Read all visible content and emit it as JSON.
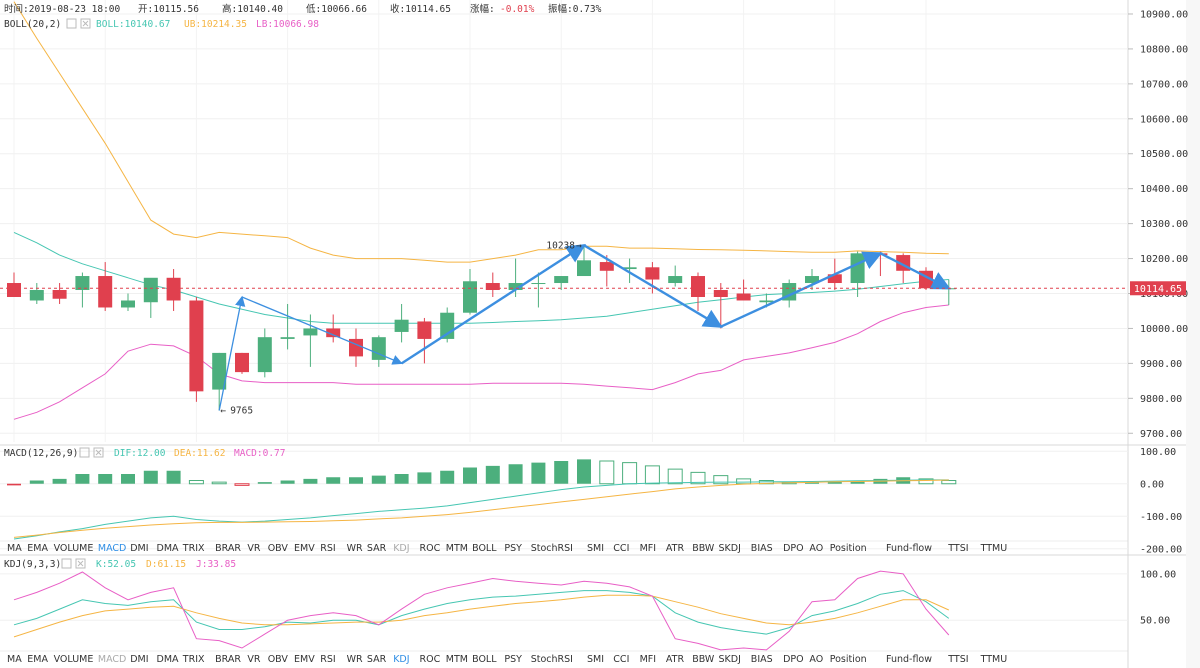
{
  "header": {
    "time": "时间:2019-08-23 18:00",
    "open": "开:10115.56",
    "high": "高:10140.40",
    "low": "低:10066.66",
    "close": "收:10114.65",
    "change_label": "涨幅:",
    "change_value": "-0.01%",
    "amplitude": "振幅:0.73%"
  },
  "boll": {
    "label": "BOLL(20,2)",
    "mid": "BOLL:10140.67",
    "ub": "UB:10214.35",
    "lb": "LB:10066.98"
  },
  "macd": {
    "label": "MACD(12,26,9)",
    "dif": "DIF:12.00",
    "dea": "DEA:11.62",
    "macd": "MACD:0.77"
  },
  "kdj": {
    "label": "KDJ(9,3,3)",
    "k": "K:52.05",
    "d": "D:61.15",
    "j": "J:33.85"
  },
  "annotations": {
    "high_marker": "10238",
    "low_marker": "9765",
    "current_price": "10114.65"
  },
  "price_axis": [
    "10900.00",
    "10800.00",
    "10700.00",
    "10600.00",
    "10500.00",
    "10400.00",
    "10300.00",
    "10200.00",
    "10100.00",
    "10000.00",
    "9900.00",
    "9800.00",
    "9700.00"
  ],
  "macd_axis": [
    "100.00",
    "0.00",
    "-100.00",
    "-200.00"
  ],
  "kdj_axis": [
    "100.00",
    "50.00"
  ],
  "indicator_tabs": [
    "MA",
    "EMA",
    "VOLUME",
    "MACD",
    "DMI",
    "DMA",
    "TRIX",
    "BRAR",
    "VR",
    "OBV",
    "EMV",
    "RSI",
    "WR",
    "SAR",
    "KDJ",
    "ROC",
    "MTM",
    "BOLL",
    "PSY",
    "StochRSI",
    "SMI",
    "CCI",
    "MFI",
    "ATR",
    "BBW",
    "SKDJ",
    "BIAS",
    "DPO",
    "AO",
    "Position",
    "Fund-flow",
    "TTSI",
    "TTMU"
  ],
  "active_tab_row1": "MACD",
  "dim_tab_row1": "KDJ",
  "active_tab_row2": "KDJ",
  "dim_tab_row2": "MACD",
  "colors": {
    "up": "#4caf7d",
    "down": "#e0404e",
    "mid_line": "#46c6b2",
    "upper_band": "#f5b544",
    "lower_band": "#e85fc6",
    "trend_arrows": "#3d8fe0",
    "macd_dif": "#46c6b2",
    "macd_dea": "#f5b544",
    "macd_value": "#e85fc6",
    "change_negative": "#e0404e"
  },
  "chart_data": [
    {
      "type": "candlestick",
      "title": "BOLL(20,2)",
      "ylim": [
        9675,
        10940
      ],
      "candles": [
        {
          "o": 10130,
          "h": 10160,
          "l": 10090,
          "c": 10090
        },
        {
          "o": 10080,
          "h": 10130,
          "l": 10070,
          "c": 10110
        },
        {
          "o": 10110,
          "h": 10130,
          "l": 10070,
          "c": 10085
        },
        {
          "o": 10110,
          "h": 10160,
          "l": 10060,
          "c": 10150
        },
        {
          "o": 10150,
          "h": 10190,
          "l": 10050,
          "c": 10060
        },
        {
          "o": 10060,
          "h": 10100,
          "l": 10050,
          "c": 10080
        },
        {
          "o": 10075,
          "h": 10140,
          "l": 10030,
          "c": 10145
        },
        {
          "o": 10145,
          "h": 10170,
          "l": 10050,
          "c": 10080
        },
        {
          "o": 10080,
          "h": 10090,
          "l": 9790,
          "c": 9820
        },
        {
          "o": 9825,
          "h": 9930,
          "l": 9765,
          "c": 9930
        },
        {
          "o": 9930,
          "h": 9930,
          "l": 9870,
          "c": 9875
        },
        {
          "o": 9875,
          "h": 10000,
          "l": 9860,
          "c": 9975
        },
        {
          "o": 9970,
          "h": 10070,
          "l": 9940,
          "c": 9975
        },
        {
          "o": 9980,
          "h": 10040,
          "l": 9890,
          "c": 10000
        },
        {
          "o": 10000,
          "h": 10040,
          "l": 9960,
          "c": 9975
        },
        {
          "o": 9970,
          "h": 10000,
          "l": 9890,
          "c": 9920
        },
        {
          "o": 9910,
          "h": 9980,
          "l": 9890,
          "c": 9975
        },
        {
          "o": 9990,
          "h": 10070,
          "l": 9960,
          "c": 10025
        },
        {
          "o": 10020,
          "h": 10030,
          "l": 9900,
          "c": 9970
        },
        {
          "o": 9970,
          "h": 10060,
          "l": 9960,
          "c": 10045
        },
        {
          "o": 10045,
          "h": 10170,
          "l": 10040,
          "c": 10135
        },
        {
          "o": 10130,
          "h": 10160,
          "l": 10090,
          "c": 10110
        },
        {
          "o": 10110,
          "h": 10200,
          "l": 10090,
          "c": 10130
        },
        {
          "o": 10130,
          "h": 10160,
          "l": 10060,
          "c": 10130
        },
        {
          "o": 10130,
          "h": 10150,
          "l": 10110,
          "c": 10150
        },
        {
          "o": 10150,
          "h": 10238,
          "l": 10150,
          "c": 10195
        },
        {
          "o": 10190,
          "h": 10210,
          "l": 10120,
          "c": 10165
        },
        {
          "o": 10170,
          "h": 10200,
          "l": 10130,
          "c": 10175
        },
        {
          "o": 10175,
          "h": 10190,
          "l": 10100,
          "c": 10140
        },
        {
          "o": 10130,
          "h": 10180,
          "l": 10120,
          "c": 10150
        },
        {
          "o": 10150,
          "h": 10160,
          "l": 10050,
          "c": 10090
        },
        {
          "o": 10110,
          "h": 10130,
          "l": 10000,
          "c": 10090
        },
        {
          "o": 10100,
          "h": 10140,
          "l": 10080,
          "c": 10080
        },
        {
          "o": 10075,
          "h": 10100,
          "l": 10060,
          "c": 10080
        },
        {
          "o": 10080,
          "h": 10140,
          "l": 10060,
          "c": 10130
        },
        {
          "o": 10130,
          "h": 10170,
          "l": 10110,
          "c": 10150
        },
        {
          "o": 10155,
          "h": 10200,
          "l": 10110,
          "c": 10130
        },
        {
          "o": 10130,
          "h": 10220,
          "l": 10090,
          "c": 10215
        },
        {
          "o": 10215,
          "h": 10220,
          "l": 10150,
          "c": 10210
        },
        {
          "o": 10210,
          "h": 10215,
          "l": 10130,
          "c": 10165
        },
        {
          "o": 10165,
          "h": 10175,
          "l": 10110,
          "c": 10115
        },
        {
          "o": 10115,
          "h": 10140,
          "l": 10067,
          "c": 10115
        }
      ],
      "series": [
        {
          "name": "BOLL",
          "values": [
            10275,
            10245,
            10210,
            10185,
            10165,
            10145,
            10125,
            10110,
            10090,
            10070,
            10055,
            10040,
            10030,
            10020,
            10015,
            10015,
            10015,
            10015,
            10015,
            10015,
            10015,
            10017,
            10020,
            10022,
            10025,
            10030,
            10035,
            10045,
            10055,
            10065,
            10075,
            10082,
            10090,
            10097,
            10100,
            10103,
            10107,
            10112,
            10120,
            10128,
            10135,
            10140
          ]
        },
        {
          "name": "UB",
          "values": [
            10935,
            10830,
            10730,
            10630,
            10530,
            10420,
            10310,
            10270,
            10260,
            10275,
            10270,
            10265,
            10260,
            10230,
            10210,
            10200,
            10200,
            10200,
            10195,
            10190,
            10190,
            10200,
            10210,
            10225,
            10225,
            10235,
            10235,
            10230,
            10230,
            10228,
            10226,
            10225,
            10224,
            10222,
            10220,
            10218,
            10218,
            10222,
            10220,
            10218,
            10215,
            10214
          ]
        },
        {
          "name": "LB",
          "values": [
            9740,
            9760,
            9790,
            9830,
            9870,
            9935,
            9955,
            9950,
            9920,
            9870,
            9850,
            9845,
            9845,
            9845,
            9845,
            9840,
            9840,
            9840,
            9840,
            9840,
            9840,
            9843,
            9843,
            9843,
            9843,
            9840,
            9835,
            9830,
            9825,
            9845,
            9870,
            9880,
            9910,
            9920,
            9930,
            9945,
            9960,
            9985,
            10020,
            10045,
            10060,
            10067
          ]
        }
      ],
      "trend_points": [
        [
          9,
          9765
        ],
        [
          10,
          10090
        ],
        [
          17,
          9900
        ],
        [
          25,
          10238
        ],
        [
          31,
          10005
        ],
        [
          38,
          10215
        ],
        [
          41,
          10115
        ]
      ]
    },
    {
      "type": "bar",
      "title": "MACD(12,26,9)",
      "ylim": [
        -210,
        110
      ],
      "values": [
        -5,
        10,
        15,
        30,
        30,
        30,
        40,
        40,
        10,
        5,
        -5,
        5,
        10,
        15,
        20,
        20,
        25,
        30,
        35,
        40,
        50,
        55,
        60,
        65,
        70,
        75,
        70,
        65,
        55,
        45,
        35,
        25,
        15,
        10,
        5,
        5,
        8,
        10,
        15,
        20,
        15,
        10
      ],
      "series": [
        {
          "name": "DIF",
          "values": [
            -170,
            -160,
            -148,
            -138,
            -125,
            -115,
            -105,
            -100,
            -110,
            -115,
            -118,
            -115,
            -110,
            -105,
            -98,
            -92,
            -85,
            -80,
            -75,
            -68,
            -58,
            -48,
            -38,
            -28,
            -18,
            -10,
            -5,
            0,
            2,
            3,
            4,
            5,
            5,
            6,
            6,
            7,
            8,
            9,
            10,
            11,
            12,
            12
          ]
        },
        {
          "name": "DEA",
          "values": [
            -165,
            -158,
            -150,
            -143,
            -137,
            -132,
            -127,
            -123,
            -120,
            -119,
            -119,
            -118,
            -117,
            -116,
            -114,
            -112,
            -108,
            -105,
            -100,
            -95,
            -88,
            -80,
            -72,
            -64,
            -56,
            -48,
            -40,
            -32,
            -24,
            -16,
            -10,
            -5,
            -1,
            1,
            3,
            4,
            6,
            7,
            8,
            9,
            10,
            11.62
          ]
        }
      ]
    },
    {
      "type": "line",
      "title": "KDJ(9,3,3)",
      "ylim": [
        20,
        115
      ],
      "series": [
        {
          "name": "K",
          "values": [
            45,
            52,
            62,
            72,
            68,
            66,
            70,
            72,
            48,
            40,
            40,
            43,
            48,
            47,
            50,
            50,
            45,
            55,
            62,
            68,
            72,
            75,
            76,
            78,
            80,
            82,
            82,
            80,
            76,
            58,
            48,
            42,
            38,
            35,
            42,
            55,
            60,
            68,
            78,
            82,
            70,
            52
          ]
        },
        {
          "name": "D",
          "values": [
            32,
            40,
            48,
            55,
            60,
            62,
            64,
            65,
            58,
            52,
            47,
            45,
            45,
            46,
            47,
            48,
            48,
            50,
            55,
            58,
            62,
            65,
            68,
            70,
            72,
            75,
            77,
            77,
            76,
            70,
            64,
            57,
            52,
            47,
            45,
            48,
            52,
            58,
            65,
            72,
            72,
            61
          ]
        },
        {
          "name": "J",
          "values": [
            72,
            80,
            90,
            102,
            85,
            72,
            80,
            85,
            30,
            28,
            20,
            35,
            50,
            55,
            58,
            55,
            45,
            62,
            78,
            85,
            90,
            95,
            92,
            90,
            88,
            92,
            90,
            86,
            76,
            30,
            25,
            18,
            20,
            18,
            38,
            70,
            72,
            95,
            103,
            100,
            62,
            34
          ]
        }
      ]
    }
  ]
}
